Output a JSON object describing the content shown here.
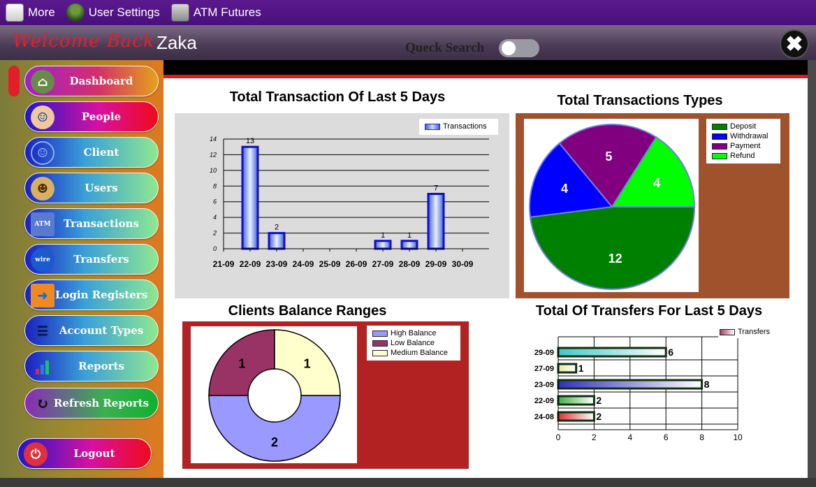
{
  "menubar": {
    "items": [
      {
        "label": "More",
        "icon": "document-icon"
      },
      {
        "label": "User Settings",
        "icon": "user-gear-icon"
      },
      {
        "label": "ATM Futures",
        "icon": "atm-icon"
      }
    ]
  },
  "header": {
    "welcome": "Welcome Back",
    "username": "Zaka",
    "search_label": "Queck Search",
    "close_icon": "close-icon"
  },
  "sidebar": {
    "items": [
      {
        "label": "Dashboard",
        "icon": "home-icon"
      },
      {
        "label": "People",
        "icon": "people-icon"
      },
      {
        "label": "Client",
        "icon": "person-icon"
      },
      {
        "label": "Users",
        "icon": "users-icon"
      },
      {
        "label": "Transactions",
        "icon": "atm-icon"
      },
      {
        "label": "Transfers",
        "icon": "wire-transfer-icon"
      },
      {
        "label": "Login Registers",
        "icon": "login-icon"
      },
      {
        "label": "Account Types",
        "icon": "list-icon"
      },
      {
        "label": "Reports",
        "icon": "bar-chart-icon"
      },
      {
        "label": "Refresh Reports",
        "icon": "refresh-icon"
      }
    ],
    "logout": {
      "label": "Logout",
      "icon": "logout-icon"
    }
  },
  "chart_data": [
    {
      "type": "bar",
      "title": "Total Transaction Of Last 5 Days",
      "categories": [
        "21-09",
        "22-09",
        "23-09",
        "24-09",
        "25-09",
        "26-09",
        "27-09",
        "28-09",
        "29-09",
        "30-09"
      ],
      "series": [
        {
          "name": "Transactions",
          "values": [
            null,
            13,
            2,
            null,
            null,
            null,
            1,
            1,
            7,
            null
          ]
        }
      ],
      "ylim": [
        0,
        14
      ],
      "yticks": [
        0,
        2,
        4,
        6,
        8,
        10,
        12,
        14
      ],
      "legend": "top-right",
      "grid": true
    },
    {
      "type": "pie",
      "title": "Total Transactions Types",
      "labels": [
        "Deposit",
        "Withdrawal",
        "Payment",
        "Refund"
      ],
      "values": [
        12,
        4,
        5,
        4
      ],
      "colors": [
        "#008000",
        "#0000ff",
        "#800080",
        "#00ff00"
      ],
      "legend": "top-right"
    },
    {
      "type": "pie",
      "title": "Clients Balance Ranges",
      "labels": [
        "High Balance",
        "Low Balance",
        "Medium Balance"
      ],
      "values": [
        2,
        1,
        1
      ],
      "colors": [
        "#9999ff",
        "#993366",
        "#ffffcc"
      ],
      "donut": true,
      "legend": "top-right"
    },
    {
      "type": "bar",
      "orientation": "horizontal",
      "title": "Total Of Transfers For  Last 5 Days",
      "categories": [
        "29-09",
        "27-09",
        "23-09",
        "22-09",
        "24-08"
      ],
      "series": [
        {
          "name": "Transfers",
          "values": [
            6,
            1,
            8,
            2,
            2
          ]
        }
      ],
      "colors": [
        "#40c8c8",
        "#e8e898",
        "#3030c0",
        "#40b040",
        "#e03030"
      ],
      "xlim": [
        0,
        10
      ],
      "xticks": [
        0,
        2,
        4,
        6,
        8,
        10
      ],
      "legend": "top-right",
      "grid": true
    }
  ]
}
